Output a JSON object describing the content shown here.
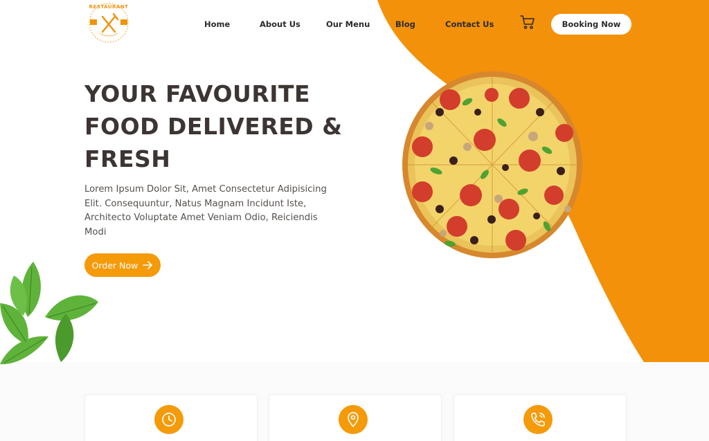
{
  "brand": {
    "logo_text": "RESTAURANT",
    "logo_icon": "fork-knife-icon"
  },
  "nav": {
    "items": [
      {
        "label": "Home"
      },
      {
        "label": "About Us"
      },
      {
        "label": "Our Menu"
      },
      {
        "label": "Blog"
      },
      {
        "label": "Contact Us"
      }
    ],
    "cart_icon": "cart-icon",
    "booking_label": "Booking Now"
  },
  "hero": {
    "title_lines": [
      "YOUR FAVOURITE",
      "FOOD DELIVERED &",
      "FRESH"
    ],
    "description": "Lorem Ipsum Dolor Sit, Amet Consectetur Adipisicing Elit. Consequuntur, Natus Magnam Incidunt Iste, Architecto Voluptate Amet Veniam Odio, Reiciendis Modi",
    "order_label": "Order Now",
    "order_icon": "arrow-right-icon",
    "image_icon": "pizza-image",
    "decor_icon": "mint-leaves-image"
  },
  "features": [
    {
      "icon": "clock-icon"
    },
    {
      "icon": "location-pin-icon"
    },
    {
      "icon": "phone-icon"
    }
  ],
  "colors": {
    "accent": "#f59a08",
    "heading": "#3d3533",
    "text": "#55504d",
    "white": "#ffffff"
  }
}
